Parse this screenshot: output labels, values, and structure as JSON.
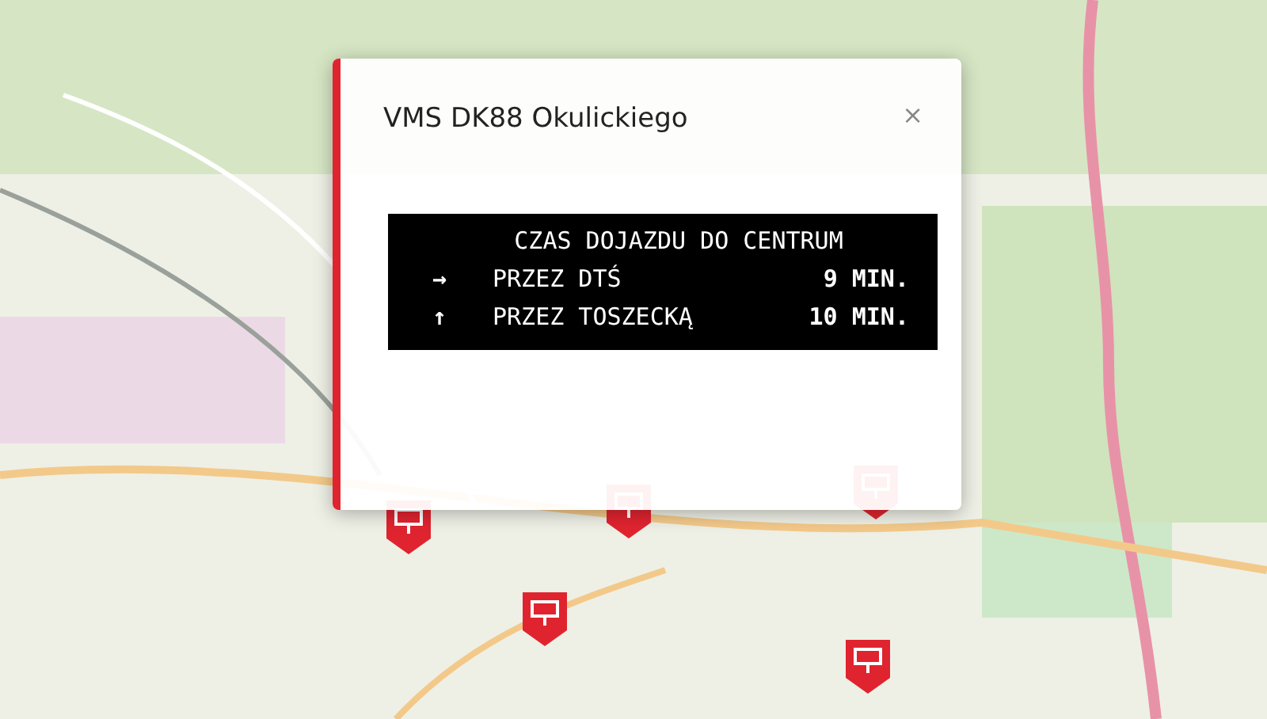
{
  "popup": {
    "title": "VMS DK88 Okulickiego",
    "close": "×",
    "sign": {
      "heading": "CZAS DOJAZDU DO CENTRUM",
      "rows": [
        {
          "arrow": "→",
          "route": "PRZEZ DTŚ",
          "time": "9 MIN."
        },
        {
          "arrow": "↑",
          "route": "PRZEZ TOSZECKĄ",
          "time": "10 MIN."
        }
      ]
    }
  }
}
